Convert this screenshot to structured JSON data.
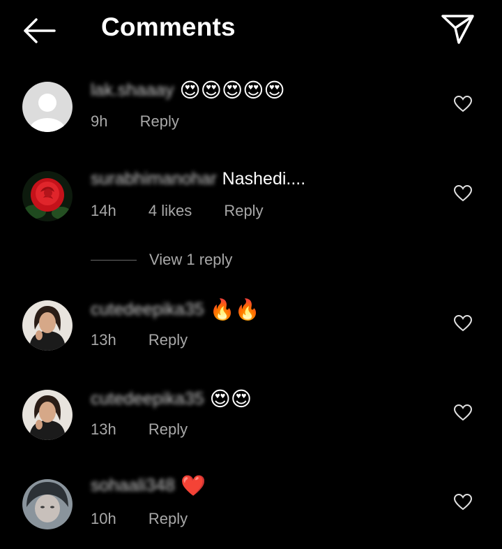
{
  "header": {
    "title": "Comments",
    "back_icon": "arrow-left-icon",
    "send_icon": "paper-plane-icon"
  },
  "comments": [
    {
      "username": "lak.shaaay",
      "text": "😍😍😍😍😍",
      "time": "9h",
      "likes": "",
      "reply": "Reply",
      "avatar": "default-avatar"
    },
    {
      "username": "surabhimanohar",
      "text": "Nashedi....",
      "time": "14h",
      "likes": "4 likes",
      "reply": "Reply",
      "avatar": "rose-avatar",
      "view_replies": "View 1 reply"
    },
    {
      "username": "cutedeepika35",
      "text": "🔥🔥",
      "time": "13h",
      "likes": "",
      "reply": "Reply",
      "avatar": "portrait-avatar"
    },
    {
      "username": "cutedeepika35",
      "text": "😍😍",
      "time": "13h",
      "likes": "",
      "reply": "Reply",
      "avatar": "portrait-avatar"
    },
    {
      "username": "sohaali348",
      "text": "❤️",
      "time": "10h",
      "likes": "",
      "reply": "Reply",
      "avatar": "portrait-avatar"
    }
  ],
  "colors": {
    "background": "#000000",
    "primary_text": "#ffffff",
    "secondary_text": "#a8a8a8"
  }
}
